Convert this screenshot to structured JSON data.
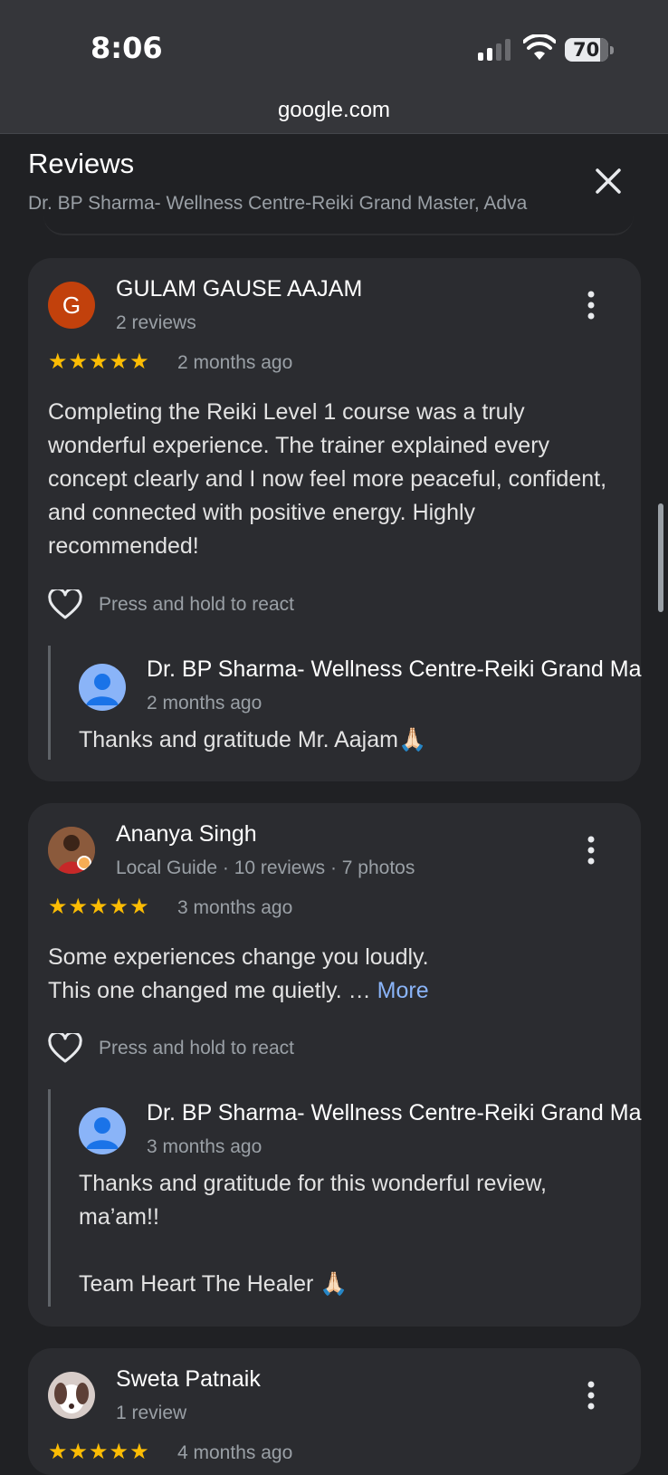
{
  "status_bar": {
    "time": "8:06",
    "battery": "70"
  },
  "browser": {
    "url": "google.com"
  },
  "sheet": {
    "title": "Reviews",
    "subtitle": "Dr. BP Sharma- Wellness Centre-Reiki Grand Master, Adva"
  },
  "reviews": [
    {
      "avatar_letter": "G",
      "name": "GULAM GAUSE AAJAM",
      "meta": "2 reviews",
      "stars": "★★★★★",
      "rating": 5,
      "date": "2 months ago",
      "text": "Completing the Reiki Level 1 course was a truly wonderful experience. The trainer explained every concept clearly and I now feel more peaceful, confident, and connected with positive energy. Highly recommended!",
      "react_label": "Press and hold to react",
      "reply": {
        "owner_name": "Dr. BP Sharma- Wellness Centre-Reiki Grand Ma",
        "date": "2 months ago",
        "text": "Thanks and gratitude Mr. Aajam🙏🏻"
      }
    },
    {
      "name": "Ananya Singh",
      "meta": "Local Guide · 10 reviews · 7 photos",
      "stars": "★★★★★",
      "rating": 5,
      "date": "3 months ago",
      "text": "Some experiences change you loudly.\nThis one changed me quietly. …",
      "more_label": "More",
      "react_label": "Press and hold to react",
      "reply": {
        "owner_name": "Dr. BP Sharma- Wellness Centre-Reiki Grand Ma",
        "date": "3 months ago",
        "text": "Thanks and gratitude for this wonderful review,\nma’am!!\n\nTeam Heart The Healer 🙏🏻"
      }
    },
    {
      "name": "Sweta Patnaik",
      "meta": "1 review",
      "stars": "★★★★★",
      "rating": 5,
      "date": "4 months ago"
    }
  ],
  "colors": {
    "background": "#202124",
    "card": "#2b2c30",
    "star": "#fbbc04",
    "link": "#8ab4f8",
    "avatar_g": "#c2410c"
  }
}
